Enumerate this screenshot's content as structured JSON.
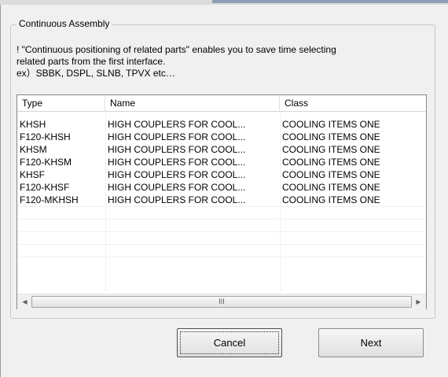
{
  "group": {
    "title": "Continuous Assembly"
  },
  "description": {
    "line1": "! \"Continuous positioning of related parts\" enables you to save time selecting",
    "line2": "related parts from the first interface.",
    "line3": "ex）SBBK, DSPL, SLNB, TPVX etc…"
  },
  "table": {
    "columns": [
      "Type",
      "Name",
      "Class"
    ],
    "rows": [
      [
        "KHSH",
        "HIGH COUPLERS FOR COOL...",
        "COOLING ITEMS ONE"
      ],
      [
        "F120-KHSH",
        "HIGH COUPLERS FOR COOL...",
        "COOLING ITEMS ONE"
      ],
      [
        "KHSM",
        "HIGH COUPLERS FOR COOL...",
        "COOLING ITEMS ONE"
      ],
      [
        "F120-KHSM",
        "HIGH COUPLERS FOR COOL...",
        "COOLING ITEMS ONE"
      ],
      [
        "KHSF",
        "HIGH COUPLERS FOR COOL...",
        "COOLING ITEMS ONE"
      ],
      [
        "F120-KHSF",
        "HIGH COUPLERS FOR COOL...",
        "COOLING ITEMS ONE"
      ],
      [
        "F120-MKHSH",
        "HIGH COUPLERS FOR COOL...",
        "COOLING ITEMS ONE"
      ]
    ]
  },
  "scrollbar": {
    "left_arrow": "◀",
    "right_arrow": "▶",
    "grip": "III"
  },
  "buttons": {
    "cancel": "Cancel",
    "next": "Next"
  }
}
